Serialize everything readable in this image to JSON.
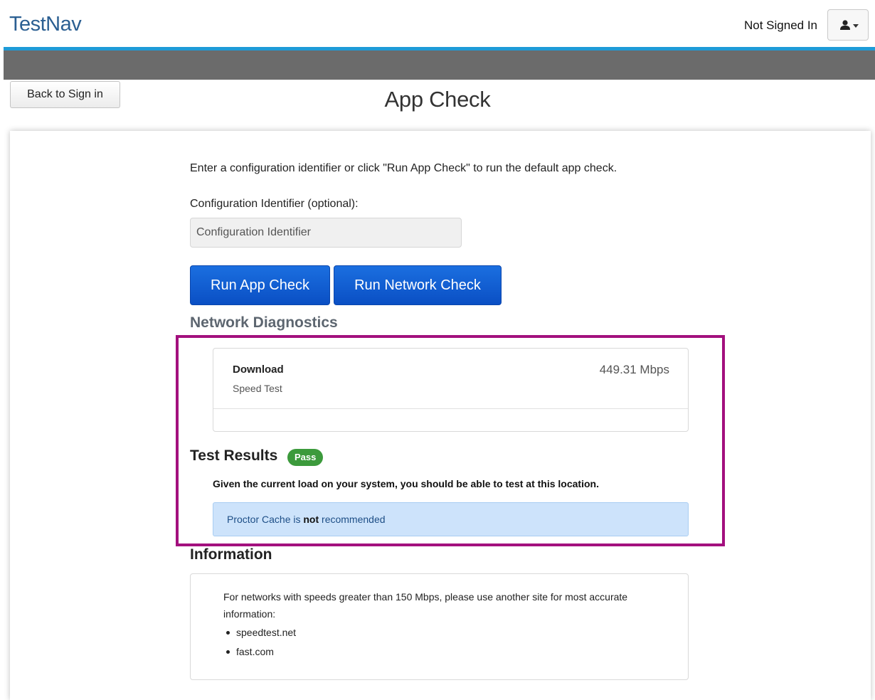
{
  "header": {
    "brand": "TestNav",
    "signin_status": "Not Signed In"
  },
  "nav": {
    "back_label": "Back to Sign in"
  },
  "page": {
    "title": "App Check"
  },
  "form": {
    "instructions": "Enter a configuration identifier or click \"Run App Check\" to run the default app check.",
    "config_label": "Configuration Identifier (optional):",
    "config_placeholder": "Configuration Identifier",
    "config_value": "",
    "run_app_label": "Run App Check",
    "run_network_label": "Run Network Check"
  },
  "diagnostics": {
    "heading": "Network Diagnostics",
    "download_title": "Download",
    "download_subtitle": "Speed Test",
    "download_value": "449.31 Mbps"
  },
  "results": {
    "heading": "Test Results",
    "badge": "Pass",
    "message": "Given the current load on your system, you should be able to test at this location.",
    "alert_prefix": "Proctor Cache is",
    "alert_emphasis": "not",
    "alert_suffix": "recommended"
  },
  "information": {
    "heading": "Information",
    "text": "For networks with speeds greater than 150 Mbps, please use another site for most accurate information:",
    "links": [
      "speedtest.net",
      "fast.com"
    ]
  },
  "colors": {
    "accent_blue": "#1e9bd7",
    "primary_button": "#0a4fc4",
    "pass_green": "#3c9a3c",
    "highlight_magenta": "#a3107e",
    "alert_bg": "#cde3fb"
  }
}
